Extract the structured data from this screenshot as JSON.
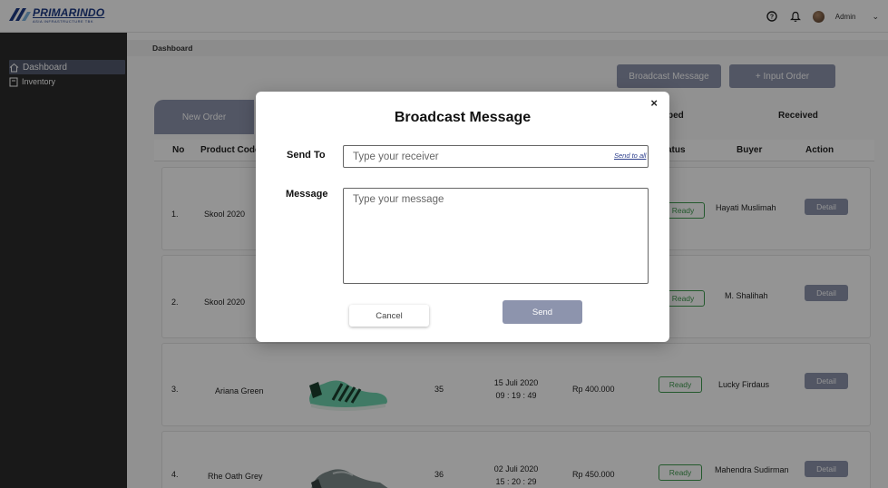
{
  "brand": {
    "name": "PRIMARINDO",
    "tagline": "ASIA INFRASTRUCTURE TBK"
  },
  "header": {
    "user_name": "Admin"
  },
  "sidebar": {
    "items": [
      {
        "label": "Dashboard"
      },
      {
        "label": "Inventory"
      }
    ]
  },
  "breadcrumb": "Dashboard",
  "actions": {
    "broadcast_label": "Broadcast Message",
    "input_order_label": "+  Input Order"
  },
  "tabs": {
    "new_order": "New Order",
    "shipped_partial": "ped",
    "received": "Received"
  },
  "table": {
    "headers": {
      "no": "No",
      "product_code": "Product Code",
      "status_partial": "atus",
      "buyer": "Buyer",
      "action": "Action"
    },
    "rows": [
      {
        "no": "1.",
        "product": "Skool 2020",
        "status": "Ready",
        "buyer": "Hayati Muslimah",
        "action": "Detail"
      },
      {
        "no": "2.",
        "product": "Skool 2020",
        "status": "Ready",
        "buyer": "M. Shalihah",
        "action": "Detail"
      },
      {
        "no": "3.",
        "product": "Ariana Green",
        "size": "35",
        "date": "15 Juli 2020",
        "time": "09 : 19 : 49",
        "price": "Rp 400.000",
        "status": "Ready",
        "buyer": "Lucky Firdaus",
        "action": "Detail"
      },
      {
        "no": "4.",
        "product": "Rhe Oath Grey",
        "size": "36",
        "date": "02 Juli 2020",
        "time": "15 : 20 : 29",
        "price": "Rp 450.000",
        "status": "Ready",
        "buyer": "Mahendra Sudirman",
        "action": "Detail"
      }
    ]
  },
  "modal": {
    "title": "Broadcast Message",
    "close": "×",
    "send_to_label": "Send To",
    "send_to_placeholder": "Type your receiver",
    "send_to_all": "Send to all",
    "message_label": "Message",
    "message_placeholder": "Type your message",
    "cancel_label": "Cancel",
    "send_label": "Send"
  },
  "colors": {
    "accent": "#8d94ad",
    "ready": "#3e9a4e",
    "sidebar": "#2b2b2b",
    "brand": "#1c3a86"
  }
}
